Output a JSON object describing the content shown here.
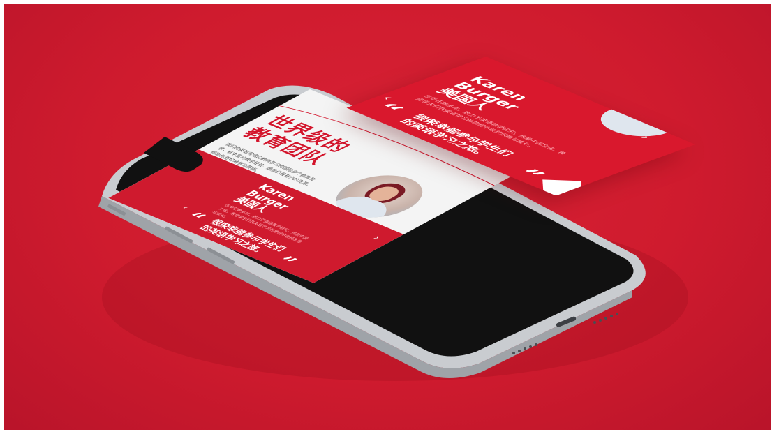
{
  "screen": {
    "title": "世界级的\n教育团队",
    "body": "我们的英语母语的教师学习的国际多个教育背景，有丰富的教学经验，是我们最有力的资源，帮助你更好地学习英语。"
  },
  "card": {
    "name": "Karen\nBurger\n美国人",
    "description": "在华任教多年，致力于英语教学研究，热爱中国文化，希望学生们在英语学习的旅程中收获乐趣与成长。",
    "quote": "很荣幸能参与学生们\n的英语学习之旅。",
    "open_quote": "“",
    "close_quote": "”",
    "prev_glyph": "‹",
    "next_glyph": "›"
  },
  "colors": {
    "background": "#cf1b2e",
    "accent": "#d3142b",
    "screen_bg": "#f4f4f4",
    "phone_frame": "#c9ccd0"
  }
}
